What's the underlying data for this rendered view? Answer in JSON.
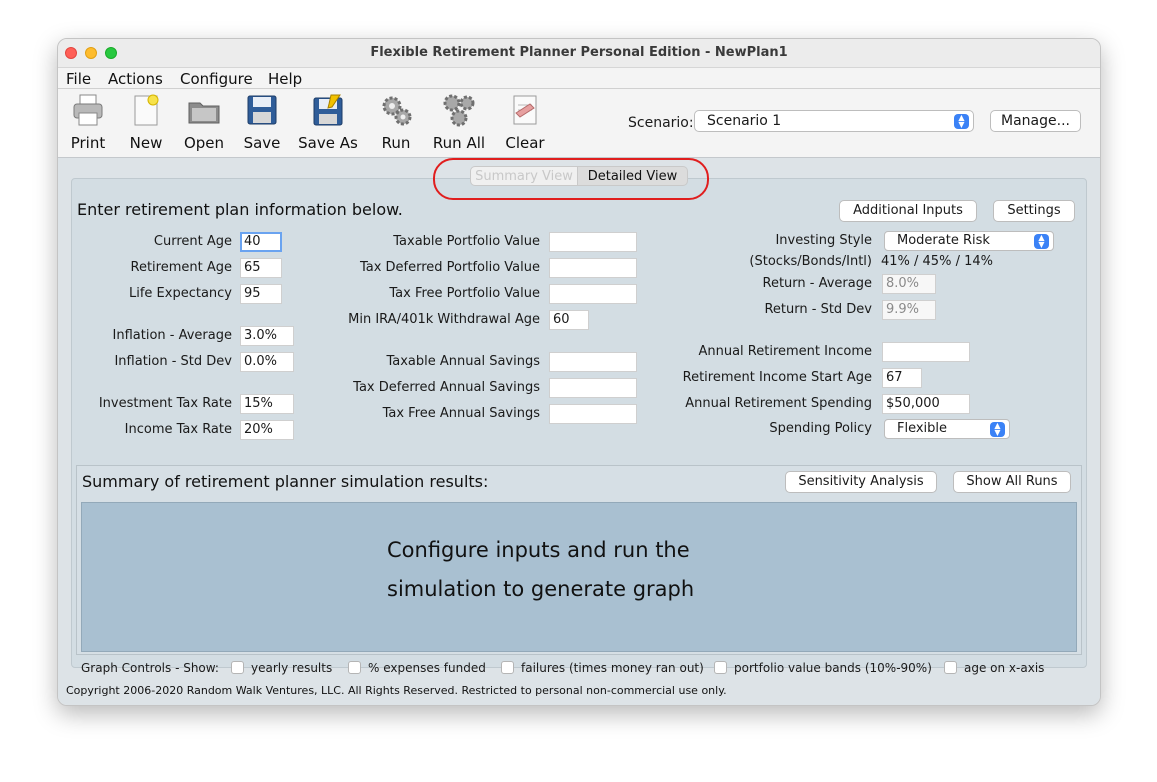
{
  "window": {
    "title": "Flexible Retirement Planner Personal Edition - NewPlan1"
  },
  "menu": [
    "File",
    "Actions",
    "Configure",
    "Help"
  ],
  "toolbar": {
    "items": [
      {
        "label": "Print",
        "icon": "printer-icon"
      },
      {
        "label": "New",
        "icon": "new-document-icon"
      },
      {
        "label": "Open",
        "icon": "folder-icon"
      },
      {
        "label": "Save",
        "icon": "floppy-disk-icon"
      },
      {
        "label": "Save As",
        "icon": "floppy-disk-edit-icon"
      },
      {
        "label": "Run",
        "icon": "gear-icon"
      },
      {
        "label": "Run All",
        "icon": "gears-icon"
      },
      {
        "label": "Clear",
        "icon": "clear-document-icon"
      }
    ],
    "scenario_label": "Scenario:",
    "scenario_value": "Scenario 1",
    "manage_label": "Manage..."
  },
  "views": {
    "summary": "Summary View",
    "detailed": "Detailed View",
    "active": "Detailed View"
  },
  "form": {
    "heading": "Enter retirement plan information below.",
    "additional_inputs": "Additional Inputs",
    "settings": "Settings",
    "left": [
      {
        "label": "Current Age",
        "value": "40"
      },
      {
        "label": "Retirement Age",
        "value": "65"
      },
      {
        "label": "Life Expectancy",
        "value": "95"
      },
      {
        "label": "Inflation - Average",
        "value": "3.0%"
      },
      {
        "label": "Inflation - Std Dev",
        "value": "0.0%"
      },
      {
        "label": "Investment Tax Rate",
        "value": "15%"
      },
      {
        "label": "Income Tax Rate",
        "value": "20%"
      }
    ],
    "middle": [
      {
        "label": "Taxable Portfolio Value",
        "value": ""
      },
      {
        "label": "Tax Deferred Portfolio Value",
        "value": ""
      },
      {
        "label": "Tax Free Portfolio Value",
        "value": ""
      },
      {
        "label": "Min IRA/401k Withdrawal Age",
        "value": "60"
      },
      {
        "label": "Taxable Annual Savings",
        "value": ""
      },
      {
        "label": "Tax Deferred Annual Savings",
        "value": ""
      },
      {
        "label": "Tax Free Annual Savings",
        "value": ""
      }
    ],
    "right": {
      "investing_style_label": "Investing Style",
      "investing_style_value": "Moderate Risk",
      "allocation_label": "(Stocks/Bonds/Intl)",
      "allocation_value": "41% / 45% / 14%",
      "return_avg_label": "Return - Average",
      "return_avg_value": "8.0%",
      "return_std_label": "Return - Std Dev",
      "return_std_value": "9.9%",
      "annual_income_label": "Annual Retirement Income",
      "annual_income_value": "",
      "income_start_label": "Retirement Income Start Age",
      "income_start_value": "67",
      "spending_label": "Annual Retirement Spending",
      "spending_value": "$50,000",
      "spending_policy_label": "Spending Policy",
      "spending_policy_value": "Flexible"
    }
  },
  "results": {
    "title": "Summary of retirement planner simulation results:",
    "sensitivity": "Sensitivity Analysis",
    "show_all_runs": "Show All Runs",
    "graph_message_line1": "Configure inputs and run the",
    "graph_message_line2": "simulation to generate graph"
  },
  "graph_controls": {
    "label": "Graph Controls - Show:",
    "options": [
      "yearly results",
      "% expenses funded",
      "failures (times money ran out)",
      "portfolio value bands (10%-90%)",
      "age on x-axis"
    ]
  },
  "footer": {
    "copyright": "Copyright 2006-2020 Random Walk Ventures, LLC.  All Rights Reserved.   Restricted to personal non-commercial use only."
  },
  "colors": {
    "accent": "#3b82f6",
    "highlight": "#e01e1e",
    "graph_bg": "#a9c0d1"
  }
}
